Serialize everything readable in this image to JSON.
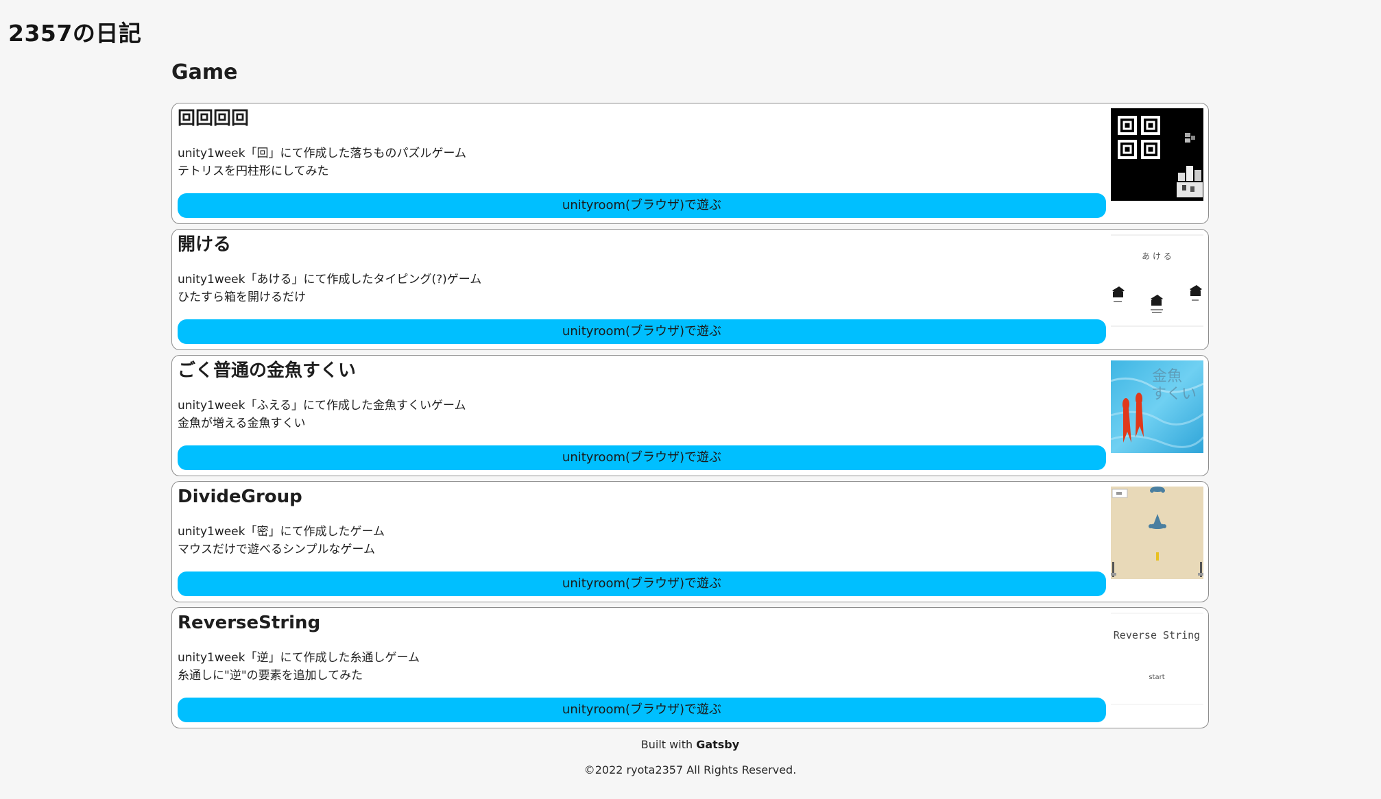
{
  "site": {
    "title": "2357の日記"
  },
  "section": {
    "title": "Game"
  },
  "games": [
    {
      "title": "回回回回",
      "desc_line1": "unity1week「回」にて作成した落ちものパズルゲーム",
      "desc_line2": "テトリスを円柱形にしてみた",
      "button_label": "unityroom(ブラウザ)で遊ぶ"
    },
    {
      "title": "開ける",
      "desc_line1": "unity1week「あける」にて作成したタイピング(?)ゲーム",
      "desc_line2": "ひたすら箱を開けるだけ",
      "button_label": "unityroom(ブラウザ)で遊ぶ",
      "thumb_text": "あ け る"
    },
    {
      "title": "ごく普通の金魚すくい",
      "desc_line1": "unity1week「ふえる」にて作成した金魚すくいゲーム",
      "desc_line2": "金魚が増える金魚すくい",
      "button_label": "unityroom(ブラウザ)で遊ぶ",
      "thumb_text_1": "金魚",
      "thumb_text_2": "すくい"
    },
    {
      "title": "DivideGroup",
      "desc_line1": "unity1week「密」にて作成したゲーム",
      "desc_line2": "マウスだけで遊べるシンプルなゲーム",
      "button_label": "unityroom(ブラウザ)で遊ぶ"
    },
    {
      "title": "ReverseString",
      "desc_line1": "unity1week「逆」にて作成した糸通しゲーム",
      "desc_line2": "糸通しに\"逆\"の要素を追加してみた",
      "button_label": "unityroom(ブラウザ)で遊ぶ",
      "thumb_title": "Reverse String",
      "thumb_start": "start"
    }
  ],
  "footer": {
    "built_prefix": "Built with ",
    "built_link": "Gatsby",
    "copyright": "©2022 ryota2357 All Rights Reserved."
  },
  "colors": {
    "background": "#f6f6f6",
    "card_border": "#8c8c8c",
    "button": "#00bfff"
  }
}
